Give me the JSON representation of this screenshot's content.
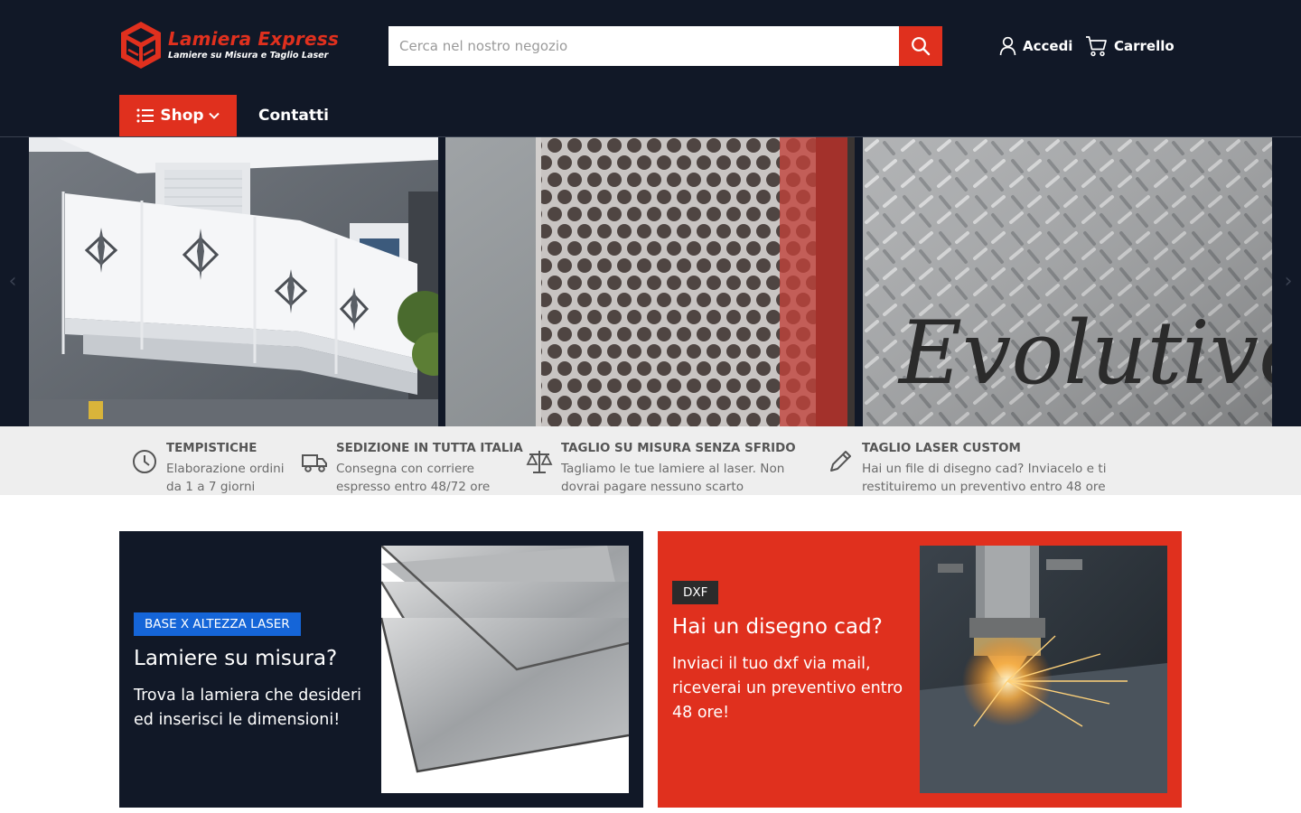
{
  "brand": {
    "name": "Lamiera Express",
    "tagline": "Lamiere su Misura e Taglio Laser",
    "accent": "#e0301e",
    "dark": "#111827"
  },
  "search": {
    "placeholder": "Cerca nel nostro negozio",
    "icon": "search-icon"
  },
  "header": {
    "account_label": "Accedi",
    "cart_label": "Carrello"
  },
  "nav": {
    "shop_label": "Shop",
    "contact_label": "Contatti"
  },
  "carousel": {
    "slides": [
      {
        "name": "balcony-laser-cut-panels"
      },
      {
        "name": "perforated-sheet"
      },
      {
        "name": "checker-plate-lettering",
        "lettering": "Evolutive"
      }
    ]
  },
  "features": [
    {
      "title": "TEMPISTICHE",
      "text": "Elaborazione ordini da 1 a 7 giorni",
      "icon": "clock-icon"
    },
    {
      "title": "SEDIZIONE IN TUTTA ITALIA",
      "text": "Consegna con corriere espresso entro 48/72 ore",
      "icon": "truck-icon"
    },
    {
      "title": "TAGLIO SU MISURA SENZA SFRIDO",
      "text": "Tagliamo le tue lamiere al laser. Non dovrai pagare nessuno scarto",
      "icon": "scale-icon"
    },
    {
      "title": "TAGLIO LASER CUSTOM",
      "text": "Hai un file di disegno cad? Inviacelo e ti restituiremo un preventivo entro 48 ore",
      "icon": "pencil-icon"
    }
  ],
  "promos": [
    {
      "badge": "BASE X ALTEZZA LASER",
      "badge_color": "#1565d8",
      "title": "Lamiere su misura?",
      "text": "Trova la lamiera che desideri ed inserisci le dimensioni!"
    },
    {
      "badge": "DXF",
      "badge_color": "#2b2b2b",
      "title": "Hai un disegno cad?",
      "text": "Inviaci il tuo dxf via mail, riceverai un preventivo entro 48 ore!"
    }
  ]
}
